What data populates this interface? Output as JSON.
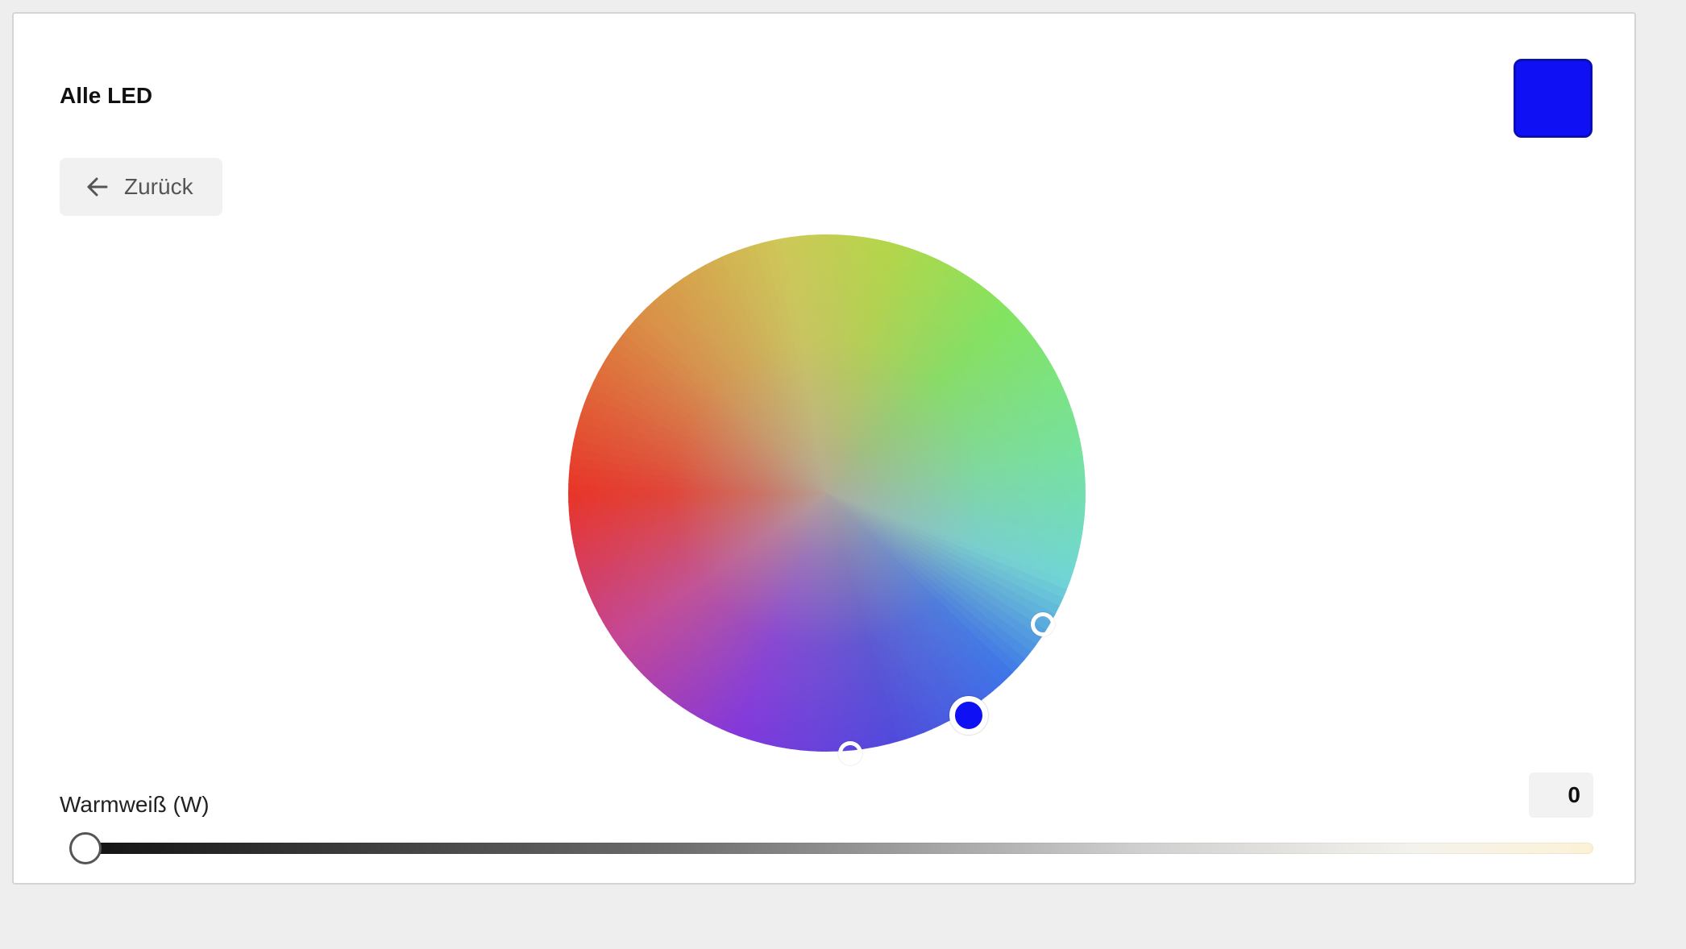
{
  "header": {
    "title": "Alle LED",
    "swatch_color": "#1010f5"
  },
  "back_button": {
    "label": "Zurück",
    "icon": "arrow-left-icon"
  },
  "color_wheel": {
    "selected_color": "#1010f5",
    "secondary_handles": [
      "light-blue-handle",
      "purple-handle"
    ]
  },
  "warmweiss": {
    "label": "Warmweiß (W)",
    "value": "0",
    "level": 0
  }
}
